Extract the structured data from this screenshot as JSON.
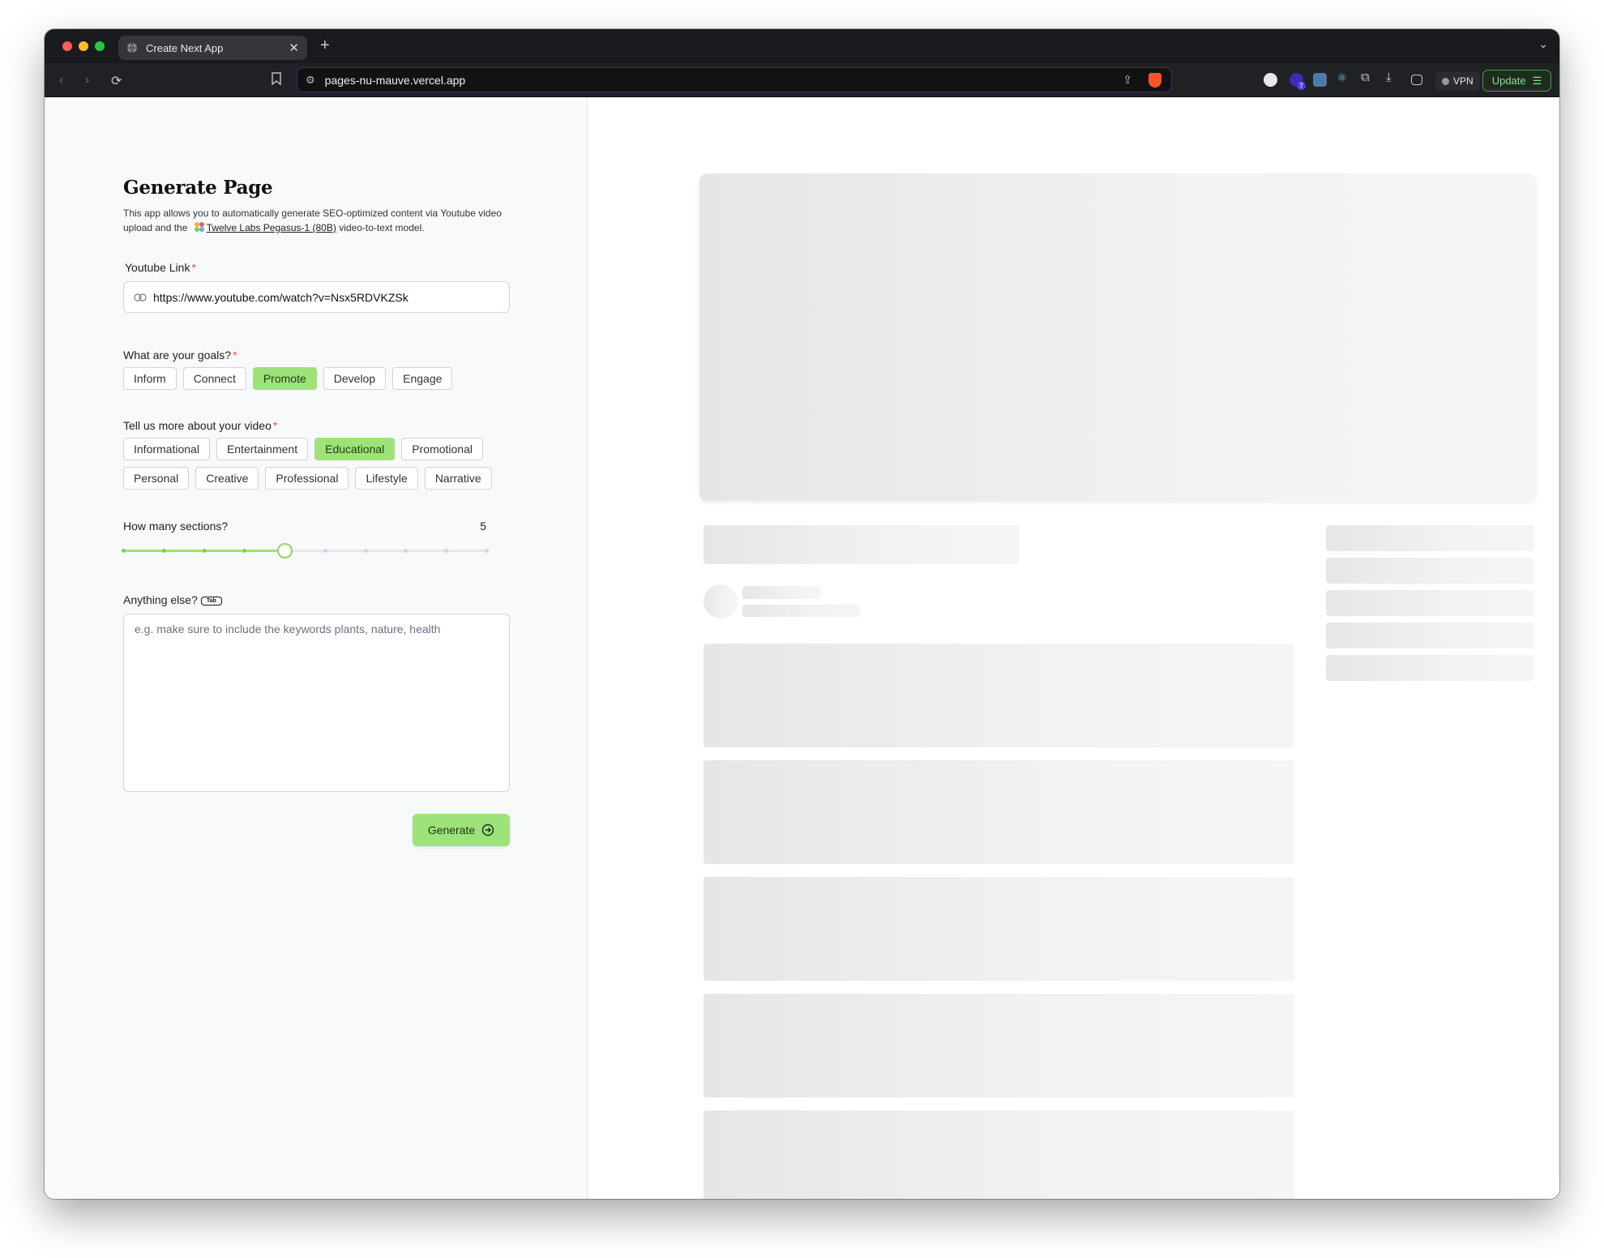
{
  "browser": {
    "tab_title": "Create Next App",
    "url": "pages-nu-mauve.vercel.app",
    "vpn_label": "VPN",
    "update_label": "Update",
    "extension_badge": "7"
  },
  "form": {
    "title": "Generate Page",
    "intro_text_1": "This app allows you to automatically generate SEO-optimized content via Youtube video upload and the",
    "intro_link": "Twelve Labs Pegasus-1 (80B)",
    "intro_text_2": "video-to-text model.",
    "youtube_label": "Youtube Link",
    "youtube_value": "https://www.youtube.com/watch?v=Nsx5RDVKZSk",
    "goals_label": "What are your goals?",
    "goals": [
      {
        "label": "Inform",
        "selected": false
      },
      {
        "label": "Connect",
        "selected": false
      },
      {
        "label": "Promote",
        "selected": true
      },
      {
        "label": "Develop",
        "selected": false
      },
      {
        "label": "Engage",
        "selected": false
      }
    ],
    "video_label": "Tell us more about your video",
    "video_types": [
      {
        "label": "Informational",
        "selected": false
      },
      {
        "label": "Entertainment",
        "selected": false
      },
      {
        "label": "Educational",
        "selected": true
      },
      {
        "label": "Promotional",
        "selected": false
      },
      {
        "label": "Personal",
        "selected": false
      },
      {
        "label": "Creative",
        "selected": false
      },
      {
        "label": "Professional",
        "selected": false
      },
      {
        "label": "Lifestyle",
        "selected": false
      },
      {
        "label": "Narrative",
        "selected": false
      }
    ],
    "sections_label": "How many sections?",
    "sections_value": "5",
    "slider": {
      "min": 1,
      "max": 10,
      "value": 5
    },
    "anything_label": "Anything else?",
    "tab_key": "Tab",
    "anything_placeholder": "e.g. make sure to include the keywords plants, nature, health",
    "generate_label": "Generate"
  },
  "colors": {
    "accent_green": "#9ee27a",
    "required_red": "#ef4444"
  }
}
